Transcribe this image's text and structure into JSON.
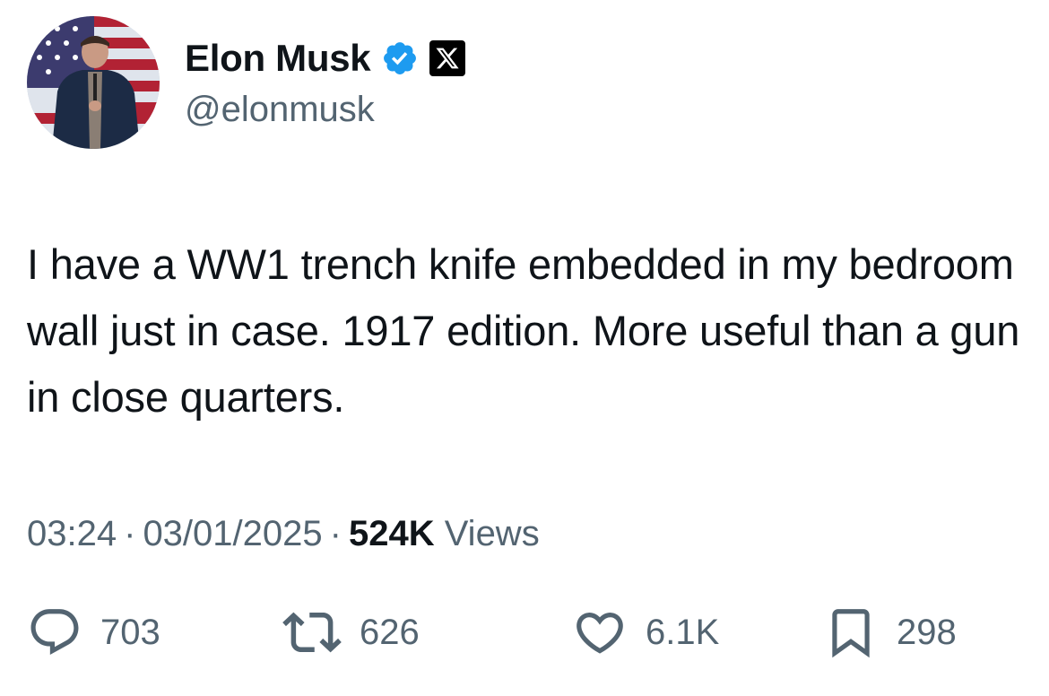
{
  "author": {
    "display_name": "Elon Musk",
    "handle": "@elonmusk",
    "verified_badge": "verified-icon",
    "affiliate_badge": "x-logo-icon"
  },
  "tweet": {
    "text": "I have a WW1 trench knife embedded in my bedroom wall just in case. 1917 edition. More useful than a gun in close quarters.",
    "time": "03:24",
    "date": "03/01/2025",
    "separator": "·",
    "views_count": "524K",
    "views_label": "Views"
  },
  "actions": {
    "replies": "703",
    "retweets": "626",
    "likes": "6.1K",
    "bookmarks": "298"
  },
  "colors": {
    "text_primary": "#0f1419",
    "text_secondary": "#536471",
    "verified_blue": "#1d9bf0",
    "background": "#ffffff"
  }
}
